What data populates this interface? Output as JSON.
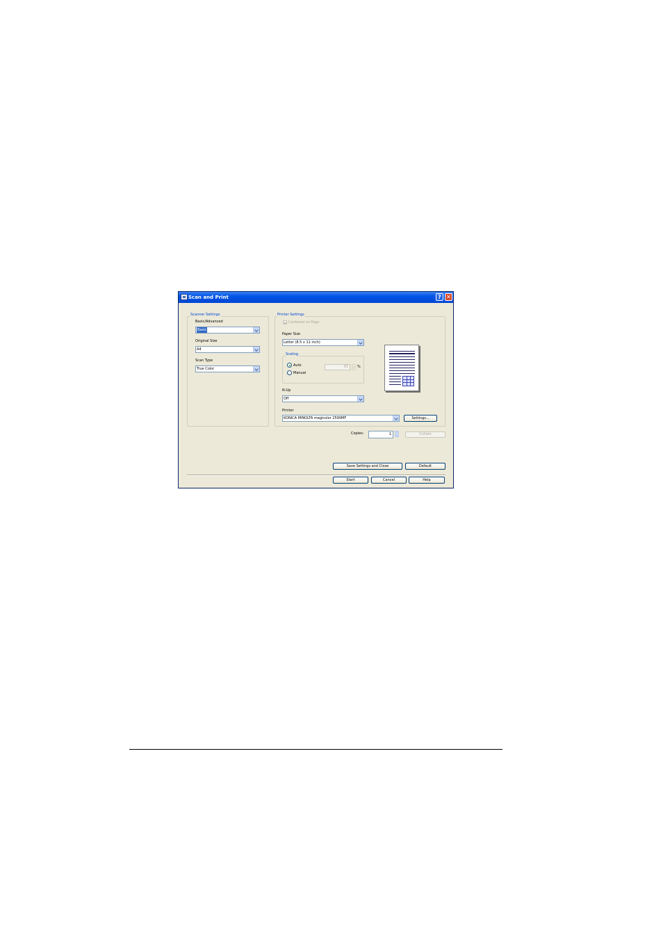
{
  "window": {
    "title": "Scan and Print",
    "help_glyph": "?",
    "close_glyph": "✕"
  },
  "scanner": {
    "group_label": "Scanner Settings",
    "mode_label": "Basic/Advanced",
    "mode_value": "Basic",
    "original_size_label": "Original Size",
    "original_size_value": "A4",
    "scan_type_label": "Scan Type",
    "scan_type_value": "True Color"
  },
  "printer": {
    "group_label": "Printer Settings",
    "centered_label": "Centered on Page",
    "paper_size_label": "Paper Size",
    "paper_size_value": "Letter (8.5 x 11 inch)",
    "scaling_label": "Scaling",
    "auto_label": "Auto",
    "manual_label": "Manual",
    "scaling_value": "93",
    "percent": "%",
    "nup_label": "N-Up",
    "nup_value": "Off",
    "printer_label": "Printer",
    "printer_value": "KONICA MINOLTA magicolor 2590MF",
    "settings_button": "Settings..."
  },
  "copies": {
    "label": "Copies:",
    "value": "1",
    "collate_button": "Collate"
  },
  "buttons": {
    "save_close": "Save Settings and Close",
    "default": "Default",
    "start": "Start",
    "cancel": "Cancel",
    "help": "Help"
  }
}
